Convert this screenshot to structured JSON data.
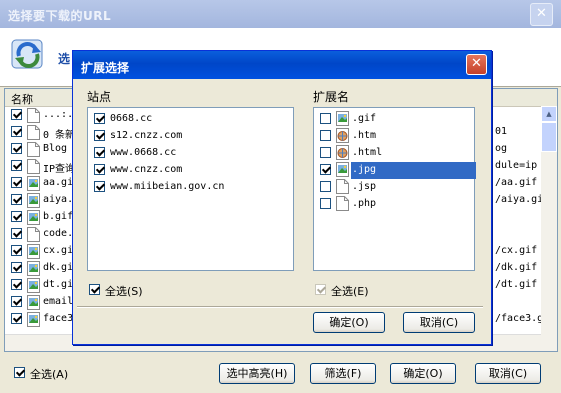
{
  "outer": {
    "title": "选择要下载的URL",
    "banner_text": "选",
    "column_name": "名称",
    "rows": [
      {
        "name": "...:...",
        "url": "",
        "icon": "page"
      },
      {
        "name": "0 条新...",
        "url": "01",
        "icon": "page"
      },
      {
        "name": "Blog",
        "url": "og",
        "icon": "page"
      },
      {
        "name": "IP查询...",
        "url": "dule=ip",
        "icon": "page"
      },
      {
        "name": "aa.gi",
        "url": "/aa.gif",
        "icon": "image"
      },
      {
        "name": "aiya.",
        "url": "/aiya.gi",
        "icon": "image"
      },
      {
        "name": "b.gif",
        "url": "",
        "icon": "image"
      },
      {
        "name": "code.",
        "url": "",
        "icon": "page"
      },
      {
        "name": "cx.gi",
        "url": "/cx.gif",
        "icon": "image"
      },
      {
        "name": "dk.gi",
        "url": "/dk.gif",
        "icon": "image"
      },
      {
        "name": "dt.gi",
        "url": "/dt.gif",
        "icon": "image"
      },
      {
        "name": "email",
        "url": "",
        "icon": "image"
      },
      {
        "name": "face3",
        "url": "/face3.g",
        "icon": "image"
      }
    ],
    "select_all_label": "全选(A)",
    "buttons": {
      "select_highlight": "选中高亮(H)",
      "filter": "筛选(F)",
      "ok": "确定(O)",
      "cancel": "取消(C)"
    }
  },
  "dialog": {
    "title": "扩展选择",
    "sites_label": "站点",
    "sites": [
      "0668.cc",
      "s12.cnzz.com",
      "www.0668.cc",
      "www.cnzz.com",
      "www.miibeian.gov.cn"
    ],
    "sites_select_all": "全选(S)",
    "ext_label": "扩展名",
    "extensions": [
      {
        "name": ".gif",
        "checked": false,
        "icon": "image"
      },
      {
        "name": ".htm",
        "checked": false,
        "icon": "html"
      },
      {
        "name": ".html",
        "checked": false,
        "icon": "html"
      },
      {
        "name": ".jpg",
        "checked": true,
        "icon": "image",
        "selected": true
      },
      {
        "name": ".jsp",
        "checked": false,
        "icon": "page"
      },
      {
        "name": ".php",
        "checked": false,
        "icon": "page"
      }
    ],
    "ext_select_all": "全选(E)",
    "ok": "确定(O)",
    "cancel": "取消(C)"
  }
}
